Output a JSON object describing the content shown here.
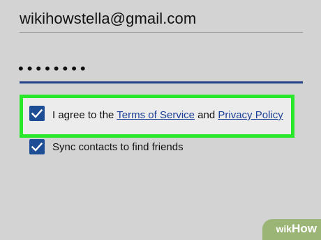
{
  "email_field": {
    "value": "wikihowstella@gmail.com"
  },
  "password_field": {
    "value": "••••••••"
  },
  "terms_row": {
    "checked": true,
    "prefix": "I agree to the ",
    "terms_link": "Terms of Service",
    "middle": " and ",
    "privacy_link": "Privacy Policy"
  },
  "sync_row": {
    "checked": true,
    "label": "Sync contacts to find friends"
  },
  "watermark": {
    "wiki": "wiki",
    "how": "How"
  },
  "colors": {
    "checkbox": "#1d4d95",
    "link": "#1c3f96",
    "highlight": "#29e82a",
    "focused_underline": "#1f3f86"
  }
}
